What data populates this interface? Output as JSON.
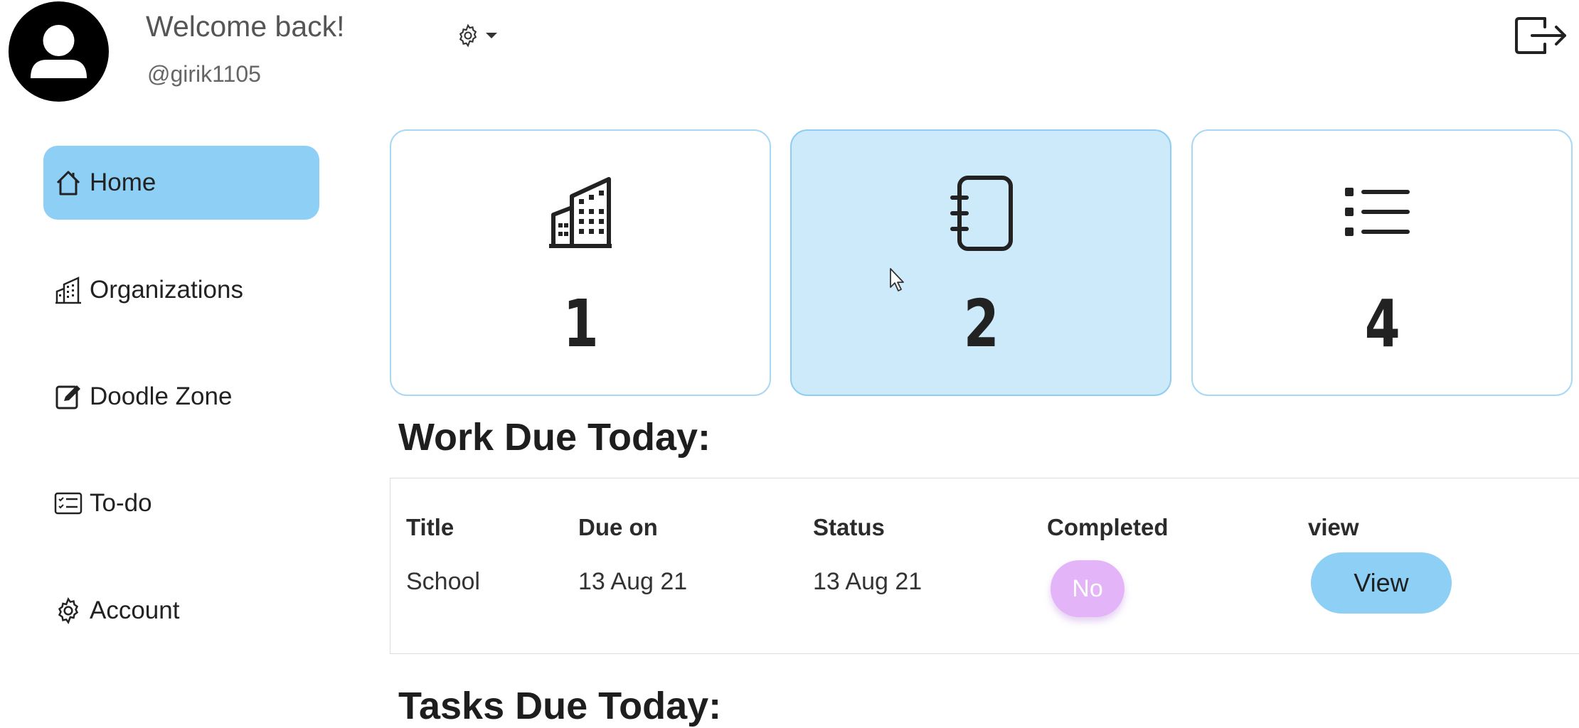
{
  "header": {
    "welcome": "Welcome back!",
    "username": "@girik1105",
    "avatar_icon": "user-avatar-icon",
    "settings_icon": "gear-icon",
    "logout_icon": "logout-icon"
  },
  "sidebar": {
    "items": [
      {
        "label": "Home",
        "icon": "home-icon",
        "active": true
      },
      {
        "label": "Organizations",
        "icon": "building-icon",
        "active": false
      },
      {
        "label": "Doodle Zone",
        "icon": "pencil-square-icon",
        "active": false
      },
      {
        "label": "To-do",
        "icon": "checklist-icon",
        "active": false
      },
      {
        "label": "Account",
        "icon": "gear-icon",
        "active": false
      }
    ],
    "accent_color": "#8ecff5"
  },
  "cards": [
    {
      "icon": "building-icon",
      "count": "1",
      "active": false
    },
    {
      "icon": "notebook-icon",
      "count": "2",
      "active": true
    },
    {
      "icon": "list-icon",
      "count": "4",
      "active": false
    }
  ],
  "work_due": {
    "title": "Work Due Today:",
    "columns": [
      "Title",
      "Due on",
      "Status",
      "Completed",
      "view"
    ],
    "rows": [
      {
        "title": "School",
        "due_on": "13 Aug 21",
        "status": "13 Aug 21",
        "completed": "No",
        "view_label": "View"
      }
    ]
  },
  "tasks_due": {
    "title": "Tasks Due Today:"
  }
}
